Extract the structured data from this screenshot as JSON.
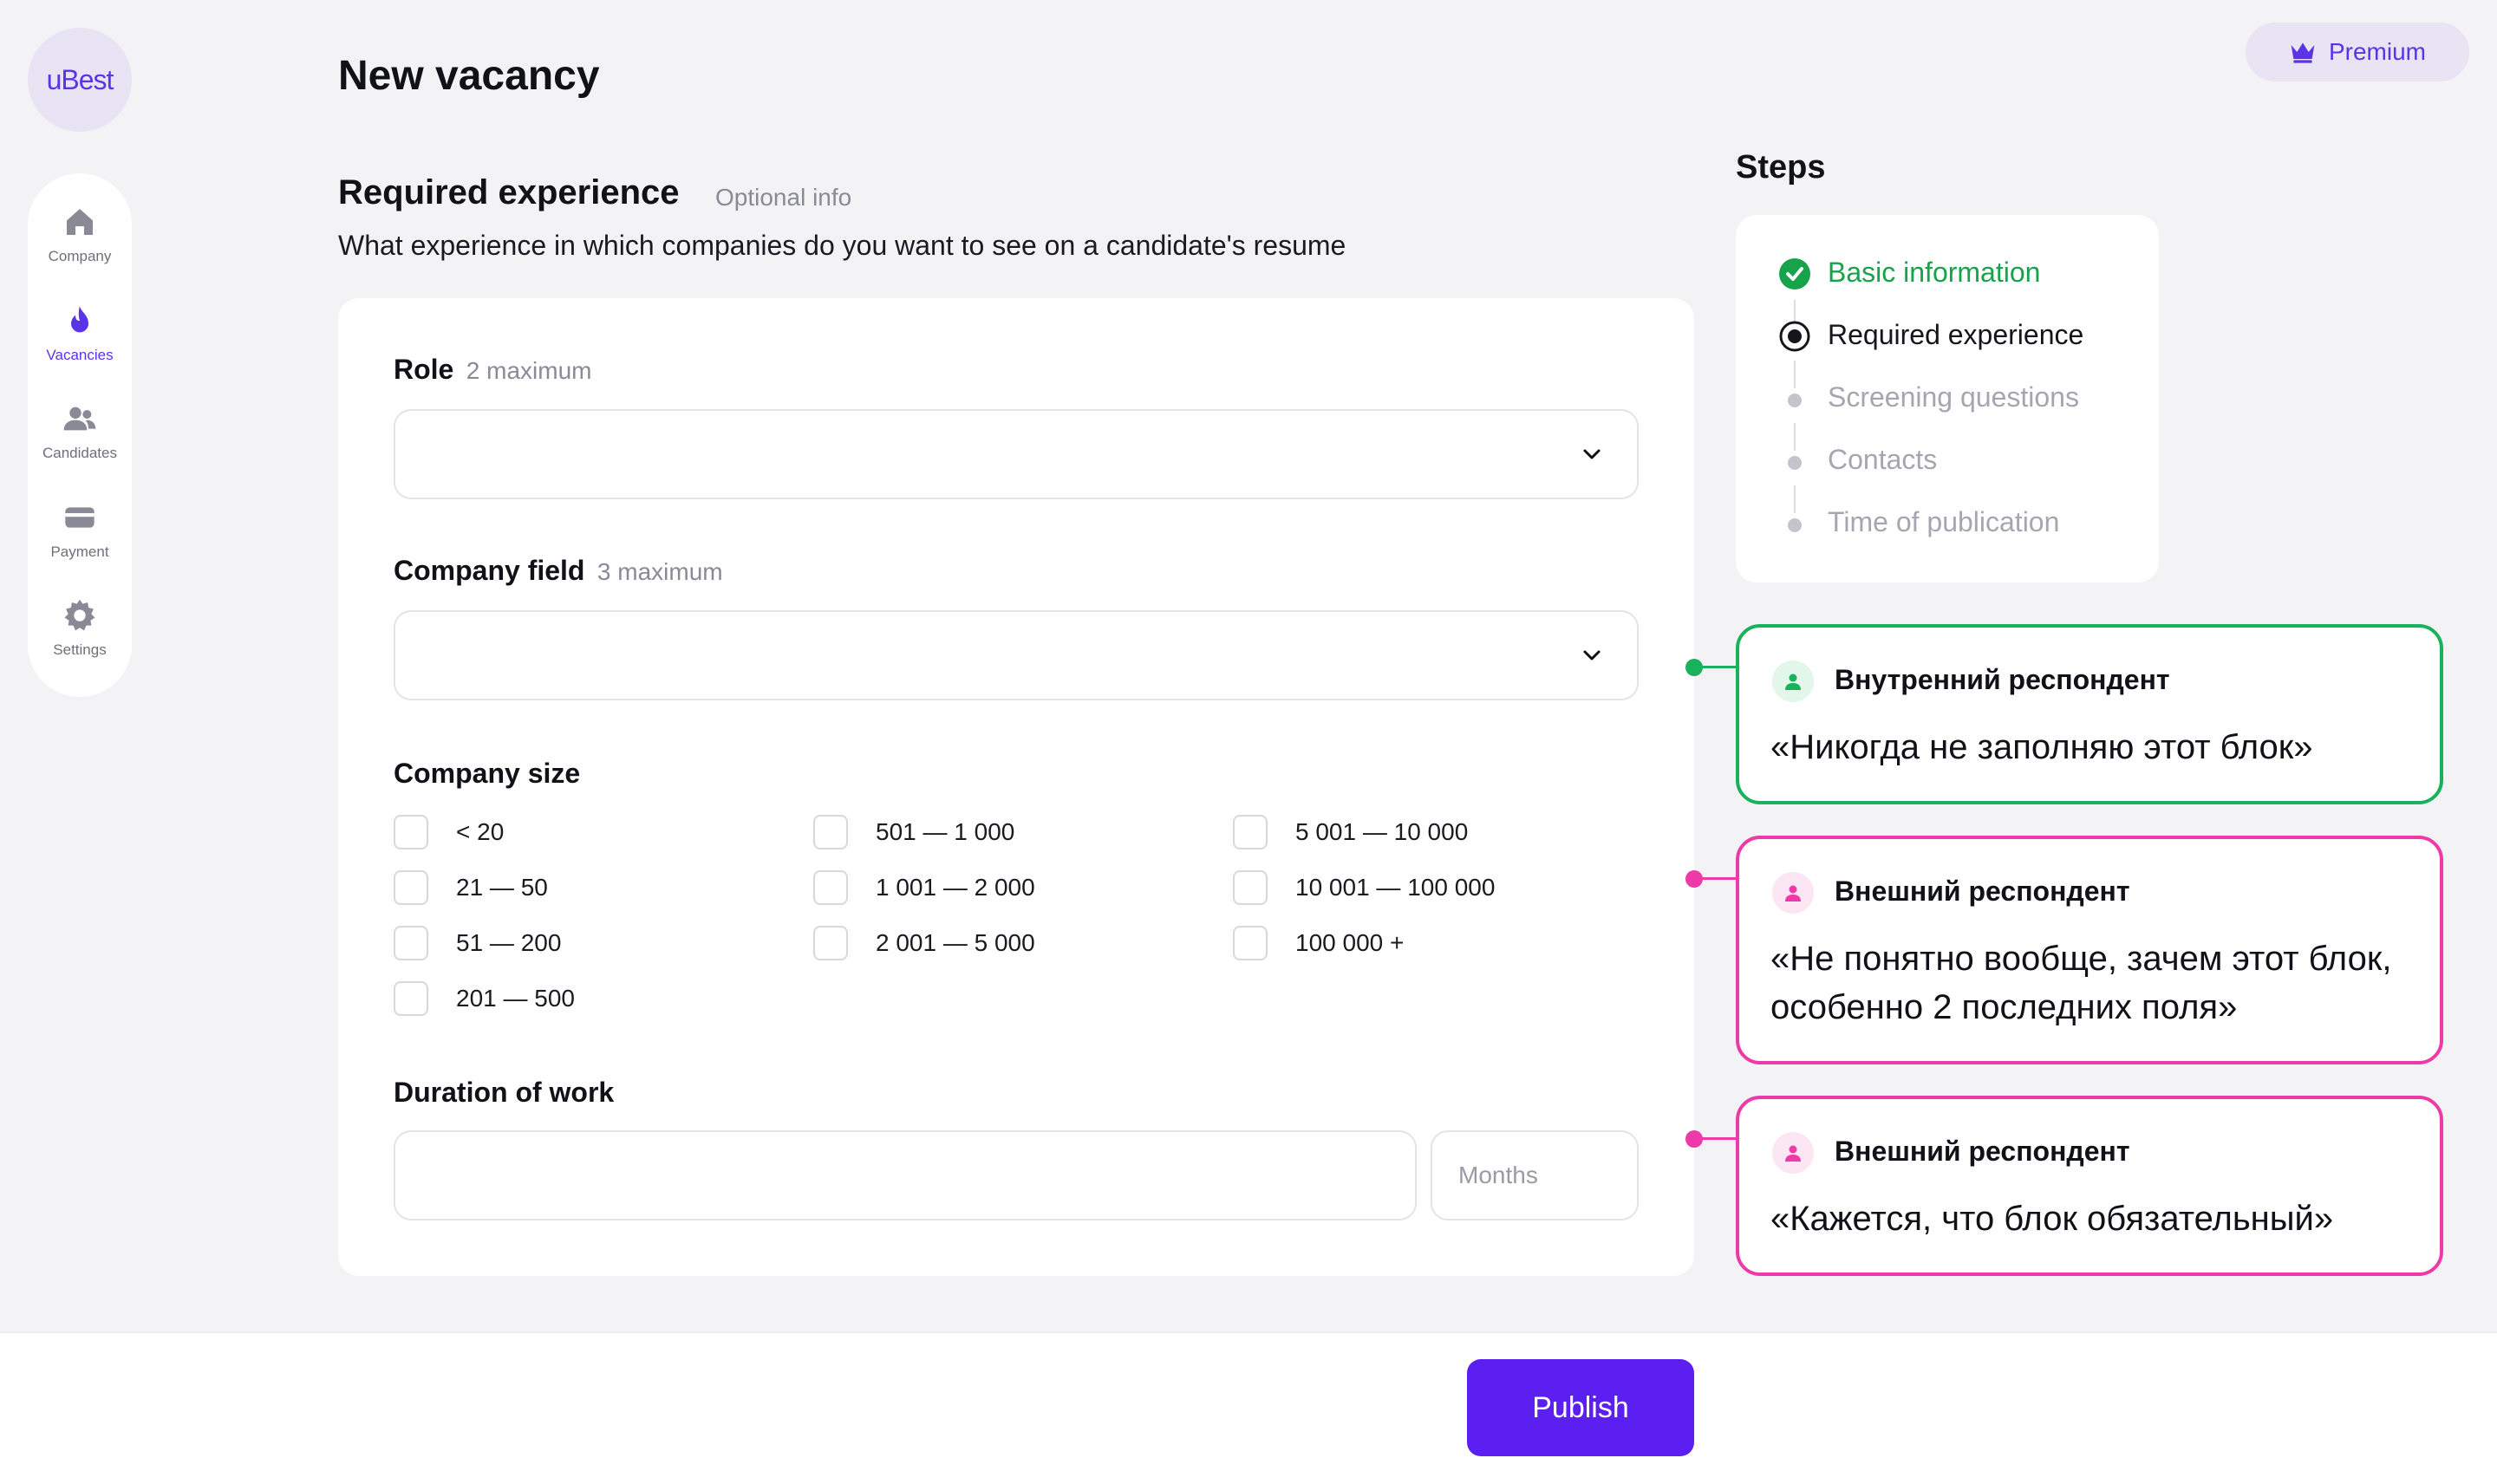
{
  "app": {
    "logo_text": "uBest"
  },
  "sidebar": {
    "items": [
      {
        "label": "Company",
        "icon": "home-icon"
      },
      {
        "label": "Vacancies",
        "icon": "flame-icon",
        "active": true
      },
      {
        "label": "Candidates",
        "icon": "users-icon"
      },
      {
        "label": "Payment",
        "icon": "card-icon"
      },
      {
        "label": "Settings",
        "icon": "gear-icon"
      }
    ]
  },
  "header": {
    "title": "New vacancy",
    "premium_label": "Premium"
  },
  "section": {
    "title": "Required experience",
    "optional": "Optional info",
    "description": "What experience in which companies do you want to see on a candidate's resume"
  },
  "form": {
    "role": {
      "label": "Role",
      "hint": "2 maximum",
      "value": ""
    },
    "company_field": {
      "label": "Company field",
      "hint": "3 maximum",
      "value": ""
    },
    "company_size": {
      "label": "Company size",
      "options": [
        "< 20",
        "21 — 50",
        "51 — 200",
        "201 — 500",
        "501 — 1 000",
        "1 001 — 2 000",
        "2 001 — 5 000",
        "5 001 — 10 000",
        "10 001 — 100 000",
        "100 000 +"
      ]
    },
    "duration": {
      "label": "Duration of work",
      "value": "",
      "unit_placeholder": "Months"
    }
  },
  "steps": {
    "title": "Steps",
    "items": [
      {
        "label": "Basic information",
        "state": "done"
      },
      {
        "label": "Required experience",
        "state": "current"
      },
      {
        "label": "Screening questions",
        "state": "pending"
      },
      {
        "label": "Contacts",
        "state": "pending"
      },
      {
        "label": "Time of publication",
        "state": "pending"
      }
    ]
  },
  "comments": [
    {
      "author": "Внутренний респондент",
      "quote": "«Никогда не заполняю этот блок»",
      "color": "#19b15c"
    },
    {
      "author": "Внешний респондент",
      "quote": "«Не понятно вообще, зачем этот блок, особенно 2 последних поля»",
      "color": "#ee3aa8"
    },
    {
      "author": "Внешний респондент",
      "quote": "«Кажется, что блок обязательный»",
      "color": "#ee3aa8"
    }
  ],
  "footer": {
    "publish_label": "Publish"
  },
  "colors": {
    "accent": "#5b1ff2",
    "brand": "#5b34e8",
    "success": "#16a34a",
    "pink": "#ee3aa8"
  }
}
